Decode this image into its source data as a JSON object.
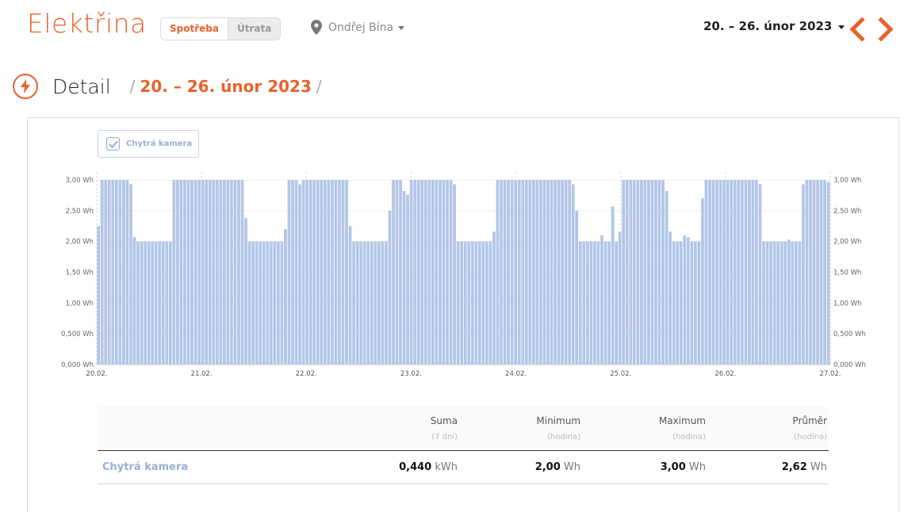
{
  "header": {
    "app_title": "Elektřina",
    "tabs": [
      {
        "label": "Spotřeba",
        "active": true
      },
      {
        "label": "Útrata",
        "active": false
      }
    ],
    "user_name": "Ondřej Bína",
    "date_range": "20. – 26. únor 2023",
    "accent_color": "#e8622c"
  },
  "detail": {
    "title": "Detail",
    "breadcrumb_sep": "/",
    "breadcrumb_date": "20. – 26. únor 2023"
  },
  "legend": {
    "label": "Chytrá kamera",
    "checked": true
  },
  "chart_data": {
    "type": "bar",
    "series_color": "#b3c6e8",
    "yunit": "Wh",
    "ylim": [
      0,
      3
    ],
    "y_ticks": [
      "0,000 Wh",
      "0,500 Wh",
      "1,00 Wh",
      "1,50 Wh",
      "2,00 Wh",
      "2,50 Wh",
      "3,00 Wh"
    ],
    "x_ticks": [
      "20.02.",
      "21.02.",
      "22.02.",
      "23.02.",
      "24.02.",
      "25.02.",
      "26.02.",
      "27.02."
    ],
    "series": [
      {
        "name": "Chytrá kamera",
        "values": [
          2.25,
          3,
          3,
          3,
          3,
          3,
          3,
          3,
          3,
          2.93,
          2.07,
          2,
          2,
          2,
          2,
          2,
          2,
          2,
          2,
          2,
          2,
          3,
          3,
          3,
          3,
          3,
          3,
          3,
          3,
          3,
          3,
          3,
          3,
          3,
          3,
          3,
          3,
          3,
          3,
          3,
          3,
          2.38,
          2,
          2,
          2,
          2,
          2,
          2,
          2,
          2,
          2,
          2,
          2.2,
          3,
          3,
          3,
          2.93,
          3,
          3,
          3,
          3,
          3,
          3,
          3,
          3,
          3,
          3,
          3,
          3,
          3,
          2.25,
          2,
          2,
          2,
          2,
          2,
          2,
          2,
          2,
          2,
          2,
          2.5,
          3,
          3,
          3,
          2.82,
          2.76,
          3,
          3,
          3,
          3,
          3,
          3,
          3,
          3,
          3,
          3,
          3,
          3,
          2.93,
          2,
          2,
          2,
          2,
          2,
          2,
          2,
          2,
          2,
          2,
          2.16,
          3,
          3,
          3,
          3,
          3,
          3,
          3,
          3,
          3,
          3,
          3,
          3,
          3,
          3,
          3,
          3,
          3,
          3,
          3,
          3,
          3,
          2.93,
          2.5,
          2,
          2,
          2,
          2,
          2,
          2,
          2.1,
          2,
          2,
          2.57,
          2,
          2.16,
          3,
          3,
          3,
          3,
          3,
          3,
          3,
          3,
          3,
          3,
          3,
          3,
          2.82,
          2.16,
          2,
          2,
          2,
          2.1,
          2.07,
          2,
          2,
          2,
          2.7,
          3,
          3,
          3,
          3,
          3,
          3,
          3,
          3,
          3,
          3,
          3,
          3,
          3,
          3,
          3,
          2.93,
          2,
          2,
          2,
          2,
          2,
          2,
          2,
          2.03,
          2,
          2,
          2,
          2.93,
          3,
          3,
          3,
          3,
          3,
          3,
          2.97
        ]
      }
    ]
  },
  "summary": {
    "headers": [
      {
        "title": "Suma",
        "sub": "(7 dní)"
      },
      {
        "title": "Minimum",
        "sub": "(hodina)"
      },
      {
        "title": "Maximum",
        "sub": "(hodina)"
      },
      {
        "title": "Průměr",
        "sub": "(hodina)"
      }
    ],
    "rows": [
      {
        "label": "Chytrá kamera",
        "suma_value": "0,440",
        "suma_unit": "kWh",
        "min_value": "2,00",
        "min_unit": "Wh",
        "max_value": "3,00",
        "max_unit": "Wh",
        "avg_value": "2,62",
        "avg_unit": "Wh"
      }
    ]
  }
}
